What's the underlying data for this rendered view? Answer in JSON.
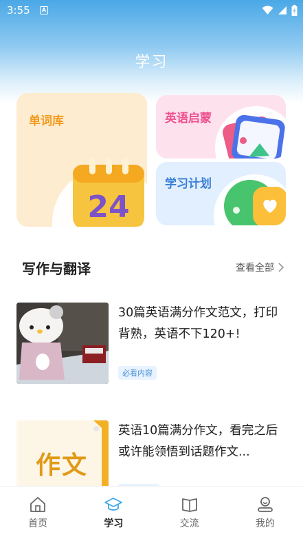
{
  "status": {
    "time": "3:55"
  },
  "header": {
    "title": "学习"
  },
  "cards": {
    "vocab": {
      "label": "单词库",
      "calendar_number": "24"
    },
    "enlight": {
      "label": "英语启蒙"
    },
    "plan": {
      "label": "学习计划"
    }
  },
  "section": {
    "title": "写作与翻译",
    "see_all": "查看全部"
  },
  "articles": [
    {
      "title": "30篇英语满分作文范文，打印背熟，英语不下120+!",
      "tag": "必看内容"
    },
    {
      "title": "英语10篇满分作文，看完之后或许能领悟到话题作文...",
      "thumb_text": "作文"
    }
  ],
  "tabbar": {
    "items": [
      {
        "label": "首页",
        "icon": "home-icon"
      },
      {
        "label": "学习",
        "icon": "study-cap-icon",
        "active": true
      },
      {
        "label": "交流",
        "icon": "book-icon"
      },
      {
        "label": "我的",
        "icon": "profile-icon"
      }
    ]
  },
  "colors": {
    "vocab": "#f29a1d",
    "enlight": "#ef4f8e",
    "plan": "#3a7fd4",
    "tag": "#4a8fd8"
  }
}
